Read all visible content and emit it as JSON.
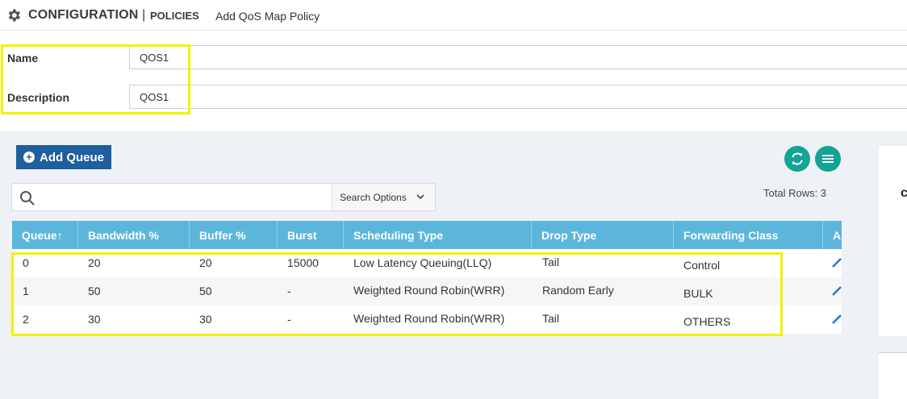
{
  "header": {
    "title": "CONFIGURATION",
    "separator": "|",
    "section": "POLICIES",
    "page": "Add QoS Map Policy"
  },
  "form": {
    "name_label": "Name",
    "name_value": "QOS1",
    "description_label": "Description",
    "description_value": "QOS1"
  },
  "toolbar": {
    "add_queue_label": "Add Queue",
    "refresh_icon": "refresh-icon",
    "menu_icon": "menu-icon"
  },
  "search": {
    "placeholder": "",
    "options_label": "Search Options"
  },
  "total_rows": "Total Rows: 3",
  "table": {
    "columns": [
      "Queue",
      "Bandwidth %",
      "Buffer %",
      "Burst",
      "Scheduling Type",
      "Drop Type",
      "Forwarding Class",
      "A"
    ],
    "sort_indicator": "↑",
    "rows": [
      {
        "queue": "0",
        "bandwidth": "20",
        "buffer": "20",
        "burst": "15000",
        "scheduling": "Low Latency Queuing(LLQ)",
        "drop": "Tail",
        "forwarding": "Control"
      },
      {
        "queue": "1",
        "bandwidth": "50",
        "buffer": "50",
        "burst": "-",
        "scheduling": "Weighted Round Robin(WRR)",
        "drop": "Random Early",
        "forwarding": "BULK"
      },
      {
        "queue": "2",
        "bandwidth": "30",
        "buffer": "30",
        "burst": "-",
        "scheduling": "Weighted Round Robin(WRR)",
        "drop": "Tail",
        "forwarding": "OTHERS"
      }
    ]
  },
  "side_panel": {
    "glyph": "c"
  },
  "colors": {
    "accent_blue": "#1f5f9e",
    "header_blue": "#5cb6dc",
    "teal": "#14a394",
    "highlight": "#f2f200"
  }
}
